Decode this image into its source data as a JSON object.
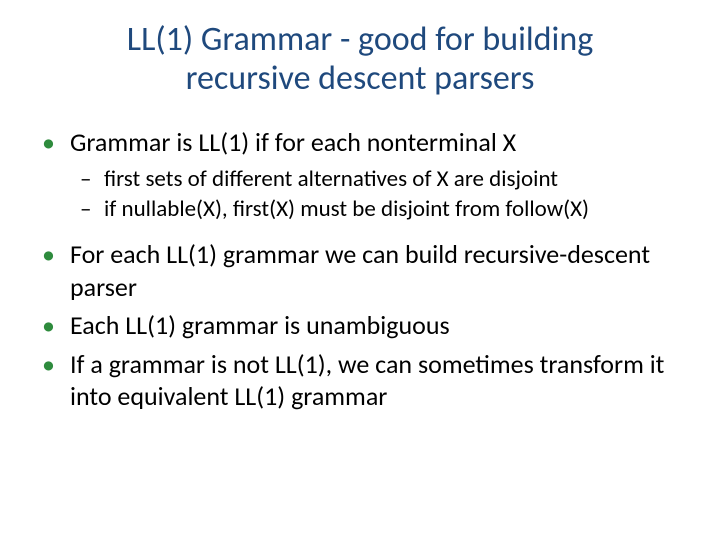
{
  "title": "LL(1) Grammar - good for building recursive descent parsers",
  "bullets": {
    "b1": "Grammar is LL(1) if for each nonterminal X",
    "b1_sub": {
      "s1": "first sets of different alternatives of X are disjoint",
      "s2": "if nullable(X), first(X) must be disjoint from follow(X)"
    },
    "b2": "For each LL(1) grammar we can build recursive-descent parser",
    "b3": "Each LL(1) grammar is unambiguous",
    "b4": "If a grammar is not LL(1), we can sometimes transform it into equivalent LL(1) grammar"
  }
}
